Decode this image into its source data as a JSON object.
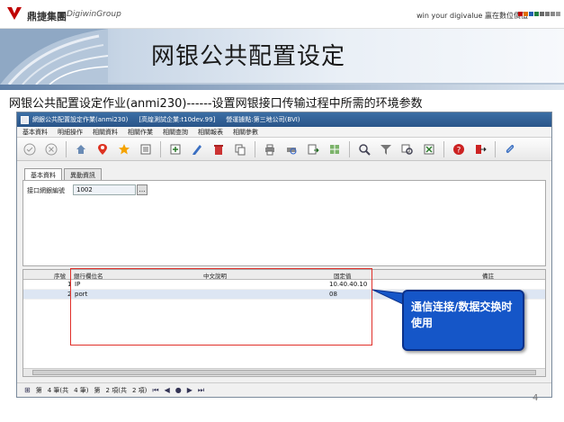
{
  "header": {
    "logo_text": "鼎捷集團",
    "logo_sub": "DigiwinGroup",
    "slogan": "win your digivalue 贏在數位價值",
    "square_colors": [
      "#c00000",
      "#e07000",
      "#2060b0",
      "#208040",
      "#6a6a6a",
      "#7a7a7a",
      "#8a8a8a",
      "#9a9a9a"
    ]
  },
  "slide": {
    "title": "网银公共配置设定",
    "subtitle": "网银公共配置设定作业(anmi230)------设置网银接口传输过程中所需的环境参数",
    "page_number": "4"
  },
  "window": {
    "title_parts": [
      "網銀公共配置設定作業(anmi230)",
      "[高煌測試企業:t10dev.99]",
      "營運據點:第三地公司(BVI)"
    ],
    "menu": [
      "基本資料",
      "明細操作",
      "相關資料",
      "相關作業",
      "相關查詢",
      "相關報表",
      "相關參數"
    ],
    "toolbar_icons": [
      "confirm-icon",
      "cancel-icon",
      "home-icon",
      "locate-icon",
      "favorite-icon",
      "list-icon",
      "add-icon",
      "edit-icon",
      "delete-icon",
      "copy-icon",
      "print-icon",
      "print-preview-icon",
      "export-icon",
      "grid-icon",
      "search-icon",
      "filter-icon",
      "query-icon",
      "export-excel-icon",
      "help-icon",
      "exit-icon",
      "attach-icon"
    ],
    "tabs": [
      "基本資料",
      "異動資訊"
    ],
    "field": {
      "label": "接口網銀編號",
      "value": "1002"
    },
    "grid": {
      "columns": [
        "序號",
        "銀行欄位名",
        "中文說明",
        "固定值",
        "備註"
      ],
      "rows": [
        {
          "seq": "1",
          "name": "IP",
          "desc": "",
          "value": "10.40.40.10",
          "note": ""
        },
        {
          "seq": "2",
          "name": "port",
          "desc": "",
          "value": "08",
          "note": ""
        }
      ]
    },
    "statusbar": {
      "page_prefix": "第",
      "page_cur": "4 筆(共",
      "page_total": "4 筆)",
      "item_prefix": "第",
      "item_cur": "2 項(共",
      "item_total": "2 項)"
    }
  },
  "callout": {
    "text": "通信连接/数据交换时使用"
  },
  "colors": {
    "banner": "#c8d6e6",
    "titlebar": "#2a5589",
    "callout": "#1556c8",
    "highlight_box": "#e0302a",
    "selected_row": "#dde6f3"
  }
}
